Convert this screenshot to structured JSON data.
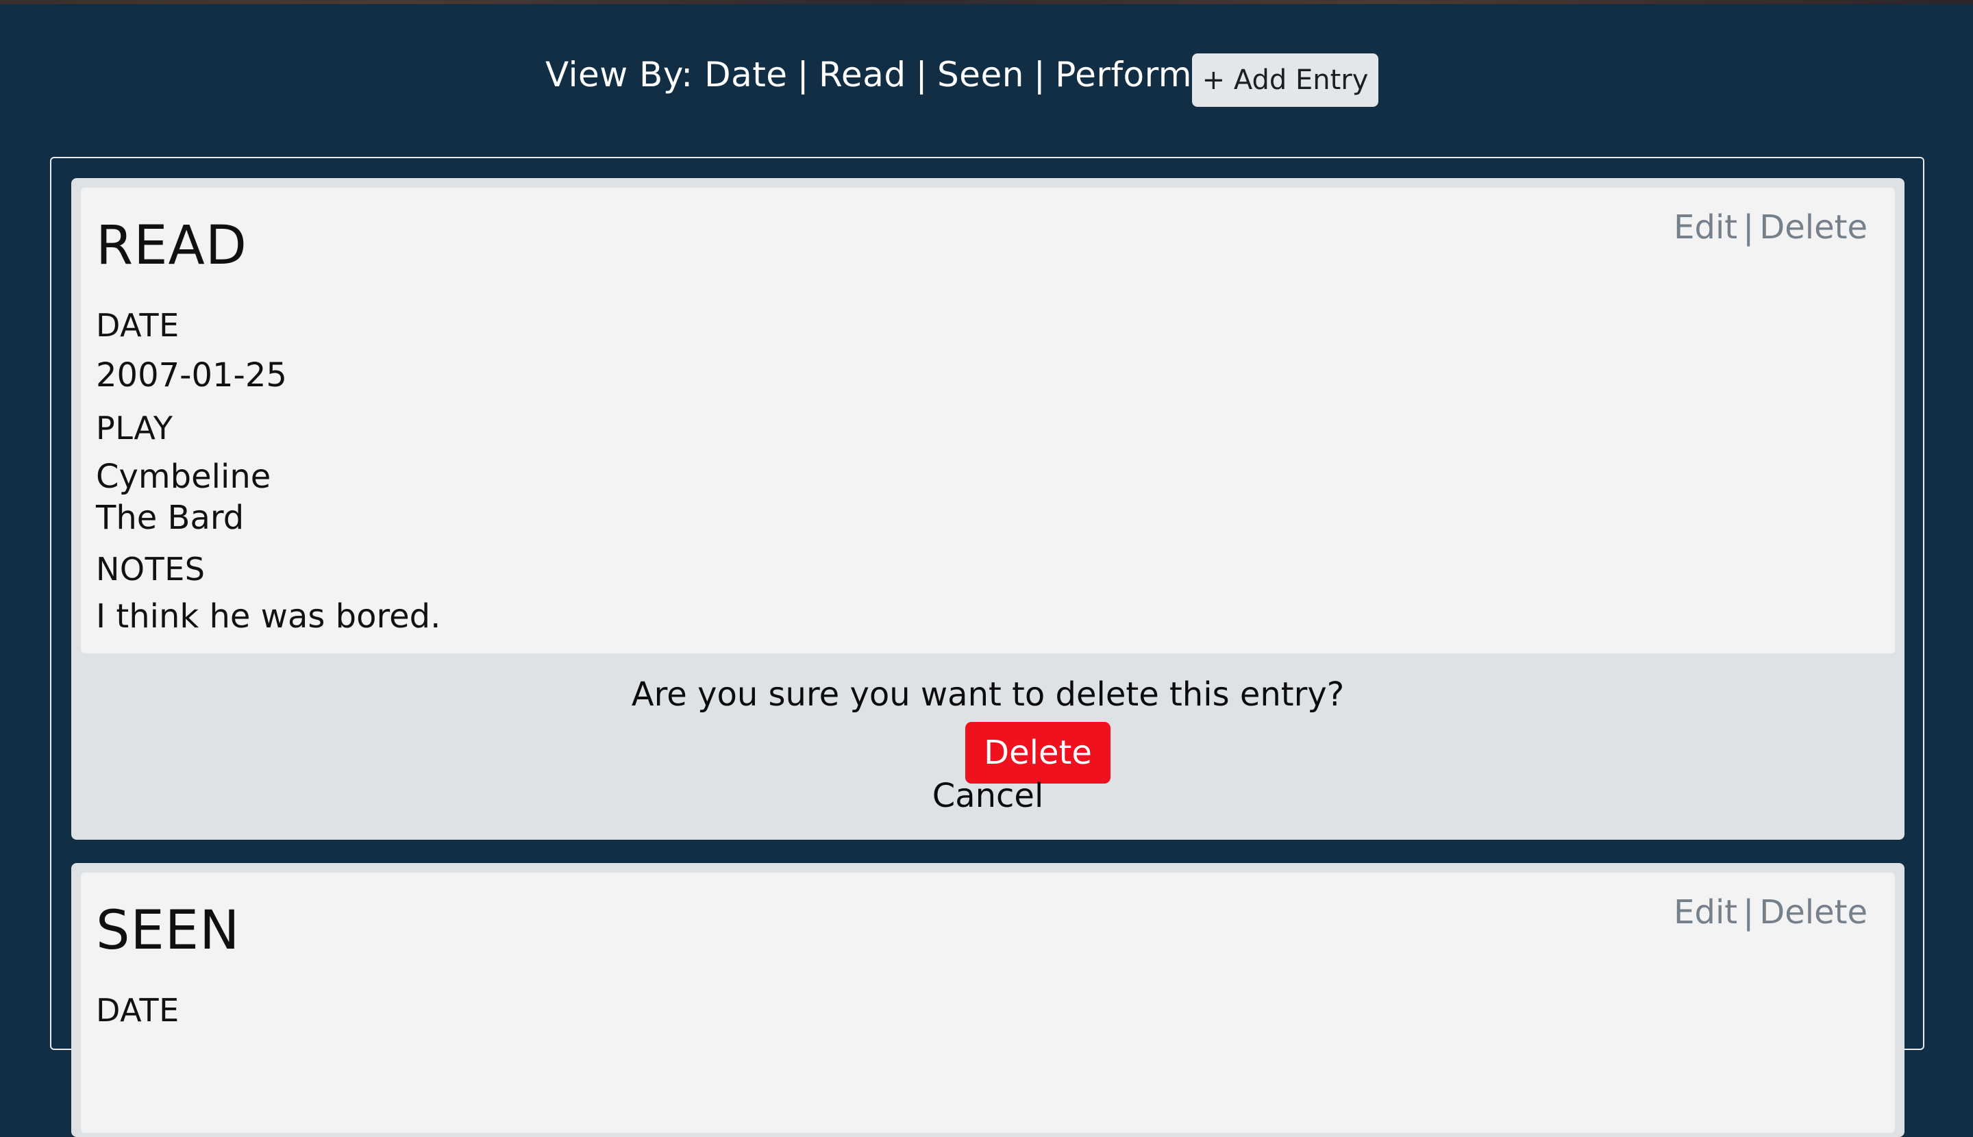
{
  "nav": {
    "view_by_label": "View By:",
    "links": [
      "Date",
      "Read",
      "Seen",
      "Performed"
    ],
    "separator": "|",
    "add_entry_label": "+ Add Entry"
  },
  "entries": [
    {
      "type_heading": "READ",
      "edit_label": "Edit",
      "separator": "|",
      "delete_label": "Delete",
      "date_label": "DATE",
      "date_value": "2007-01-25",
      "play_label": "PLAY",
      "play_title": "Cymbeline",
      "play_author": "The Bard",
      "notes_label": "NOTES",
      "notes_value": "I think he was bored.",
      "confirm": {
        "message": "Are you sure you want to delete this entry?",
        "delete_button": "Delete",
        "cancel_link": "Cancel"
      }
    },
    {
      "type_heading": "SEEN",
      "edit_label": "Edit",
      "separator": "|",
      "delete_label": "Delete",
      "date_label": "DATE"
    }
  ],
  "colors": {
    "background": "#112e45",
    "card_outer": "#dfe2e5",
    "card_inner": "#f3f3f3",
    "link_muted": "#76808b",
    "danger": "#f0111f"
  }
}
